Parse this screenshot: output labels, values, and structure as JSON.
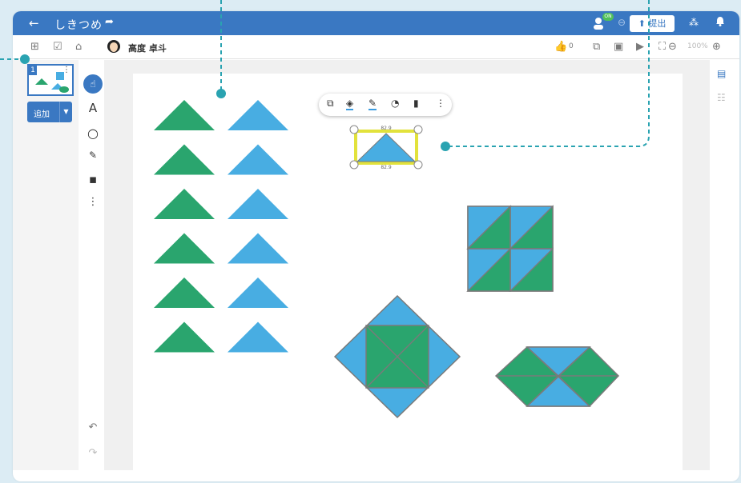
{
  "titlebar": {
    "back_icon": "←",
    "title": "しきつめ",
    "share_icon": "➦",
    "online_badge": "ON",
    "link_icon": "⊖",
    "submit_label": "⬆ 提出",
    "broadcast_icon": "⁂",
    "bell_icon": "♪"
  },
  "toolbar": {
    "grid_icon": "⊞",
    "check_icon": "☑",
    "home_icon": "⌂",
    "user_name": "高度 卓斗",
    "like_icon": "👍",
    "like_count": "0",
    "copy_icon": "⧉",
    "present_icon": "▣",
    "play_icon": "▶",
    "fullscreen_icon": "⛶",
    "zoom_out_icon": "⊖",
    "zoom_level": "100%",
    "zoom_in_icon": "⊕"
  },
  "left_panel": {
    "page_number": "1",
    "page_menu_icon": "⋮",
    "add_label": "追加",
    "add_dropdown_icon": "▼"
  },
  "tools": {
    "pointer_icon": "☝",
    "text_tool": "A",
    "shape_tool": "○",
    "pen_tool": "✎",
    "image_tool": "▪",
    "more_tool": "⋮",
    "undo": "↶",
    "redo": "↷"
  },
  "shape_toolbar": {
    "copy": "⧉",
    "fill": "◈",
    "stroke": "✎",
    "opacity": "◔",
    "delete": "▮",
    "more": "⋮"
  },
  "selection": {
    "width_label": "82.9",
    "height_label": "82.9"
  },
  "right_rail": {
    "comment_icon": "▤",
    "users_icon": "☷"
  },
  "colors": {
    "brand_blue": "#3a78c2",
    "triangle_green": "#2aa56e",
    "triangle_blue": "#48ade2",
    "selection_yellow": "#e2e23c",
    "callout_teal": "#2aa3b1"
  }
}
